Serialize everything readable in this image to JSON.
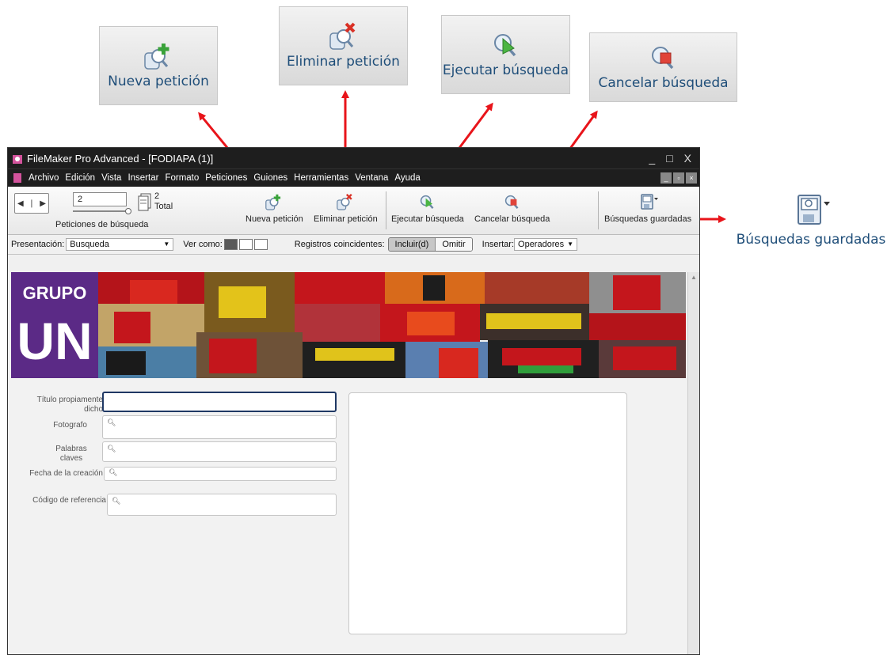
{
  "window": {
    "title": "FileMaker Pro Advanced - [FODIAPA (1)]",
    "controls": [
      "_",
      "□",
      "X"
    ]
  },
  "menu": [
    "Archivo",
    "Edición",
    "Vista",
    "Insertar",
    "Formato",
    "Peticiones",
    "Guiones",
    "Herramientas",
    "Ventana",
    "Ayuda"
  ],
  "toolbar": {
    "record_number": "2",
    "total_count": "2",
    "total_label": "Total",
    "navigator_label": "Peticiones de búsqueda",
    "buttons": {
      "nueva": "Nueva petición",
      "eliminar": "Eliminar petición",
      "ejecutar": "Ejecutar búsqueda",
      "cancelar": "Cancelar búsqueda",
      "guardadas": "Búsquedas guardadas"
    }
  },
  "modebar": {
    "presentacion_label": "Presentación:",
    "presentacion_value": "Busqueda",
    "ver_como_label": "Ver como:",
    "registros_label": "Registros coincidentes:",
    "incluir": "Incluir(d)",
    "omitir": "Omitir",
    "insertar_label": "Insertar:",
    "insertar_value": "Operadores"
  },
  "banner": {
    "logo_top": "GRUPO",
    "logo_bottom": "UN"
  },
  "form": {
    "titulo": "Título propiamente dicho",
    "fotografo": "Fotografo",
    "palabras": "Palabras claves",
    "fecha": "Fecha de la creación",
    "codigo": "Código de referencia"
  },
  "callouts": {
    "nueva": "Nueva petición",
    "eliminar": "Eliminar petición",
    "ejecutar": "Ejecutar búsqueda",
    "cancelar": "Cancelar búsqueda",
    "guardadas": "Búsquedas guardadas"
  },
  "colors": {
    "arrow": "#e8141a",
    "callout_text": "#1f4e79",
    "logo_purple": "#5b2a86",
    "photo_red": "#c4161c"
  }
}
